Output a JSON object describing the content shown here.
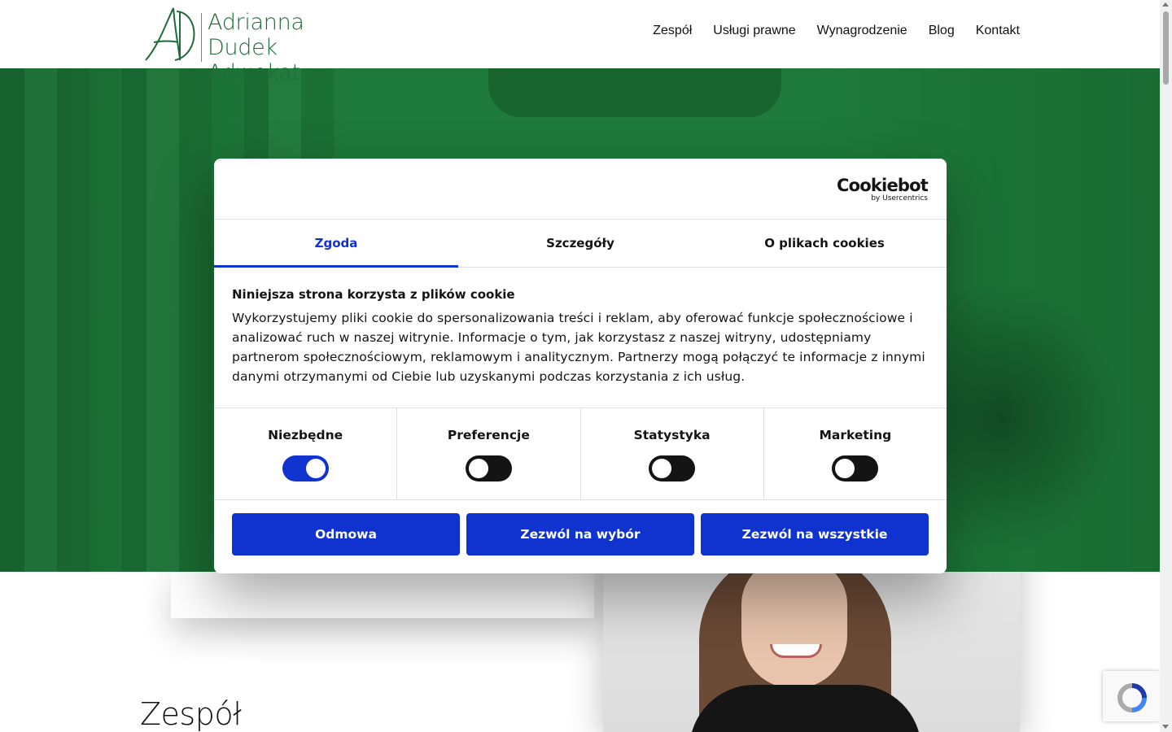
{
  "header": {
    "logo": {
      "monogram": "AD",
      "line1": "Adrianna Dudek",
      "line2": "Adwokat"
    },
    "nav": [
      "Zespół",
      "Usługi prawne",
      "Wynagrodzenie",
      "Blog",
      "Kontakt"
    ]
  },
  "main": {
    "section_title": "Zespół"
  },
  "cookie_dialog": {
    "brand": "Cookiebot",
    "brand_sub": "by Usercentrics",
    "tabs": [
      {
        "label": "Zgoda",
        "active": true
      },
      {
        "label": "Szczegóły",
        "active": false
      },
      {
        "label": "O plikach cookies",
        "active": false
      }
    ],
    "heading": "Niniejsza strona korzysta z plików cookie",
    "body": "Wykorzystujemy pliki cookie do spersonalizowania treści i reklam, aby oferować funkcje społecznościowe i analizować ruch w naszej witrynie. Informacje o tym, jak korzystasz z naszej witryny, udostępniamy partnerom społecznościowym, reklamowym i analitycznym. Partnerzy mogą połączyć te informacje z innymi danymi otrzymanymi od Ciebie lub uzyskanymi podczas korzystania z ich usług.",
    "toggles": [
      {
        "label": "Niezbędne",
        "on": true
      },
      {
        "label": "Preferencje",
        "on": false
      },
      {
        "label": "Statystyka",
        "on": false
      },
      {
        "label": "Marketing",
        "on": false
      }
    ],
    "buttons": {
      "deny": "Odmowa",
      "allow_selection": "Zezwól na wybór",
      "allow_all": "Zezwól na wszystkie"
    }
  },
  "colors": {
    "brand_green": "#1e6b3a",
    "hero_green": "#1d7a3a",
    "accent_blue": "#1032cf"
  }
}
